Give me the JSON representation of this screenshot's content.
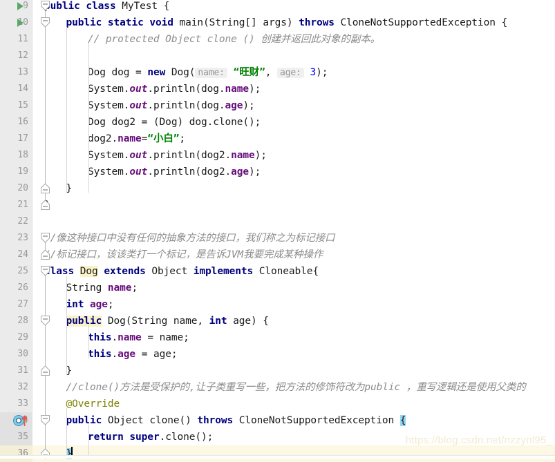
{
  "editor": {
    "app": "intellij-idea-code-editor",
    "language": "Java",
    "first_line_number": 9,
    "current_line": 36,
    "colors": {
      "background": "#ffffff",
      "gutter_background": "#ebebeb",
      "line_number": "#999999",
      "keyword": "#000080",
      "string": "#008000",
      "number": "#0000ff",
      "field": "#660e7a",
      "comment": "#8c8c8c",
      "annotation": "#808000",
      "current_line_highlight": "#fdf8e3",
      "identifier_highlight": "#fbf3c8",
      "brace_match_highlight": "#93d5f5",
      "run_marker_green": "#59a869",
      "override_icon_blue": "#4aa3df",
      "override_arrow_red": "#d9534f"
    },
    "watermark": "https://blog.csdn.net/nzzynl95_"
  },
  "lines": [
    {
      "num": "9",
      "gutter_icon": "run-triangle",
      "fold": "start",
      "indent": 0,
      "tokens": [
        {
          "t": "public",
          "c": "kw"
        },
        {
          "t": " ",
          "c": "plain"
        },
        {
          "t": "class",
          "c": "kw"
        },
        {
          "t": " MyTest {",
          "c": "plain"
        }
      ]
    },
    {
      "num": "10",
      "gutter_icon": "run-triangle",
      "fold": "start",
      "indent": 1,
      "tokens": [
        {
          "t": "public",
          "c": "kw"
        },
        {
          "t": " ",
          "c": "plain"
        },
        {
          "t": "static",
          "c": "kw"
        },
        {
          "t": " ",
          "c": "plain"
        },
        {
          "t": "void",
          "c": "kw"
        },
        {
          "t": " main(String[] args) ",
          "c": "plain"
        },
        {
          "t": "throws",
          "c": "kw"
        },
        {
          "t": " CloneNotSupportedException {",
          "c": "plain"
        }
      ]
    },
    {
      "num": "11",
      "gutter_icon": "",
      "fold": "",
      "indent": 2,
      "tokens": [
        {
          "t": "// protected Object clone () 创建并返回此对象的副本。",
          "c": "cmt"
        }
      ]
    },
    {
      "num": "12",
      "gutter_icon": "",
      "fold": "",
      "indent": 2,
      "tokens": []
    },
    {
      "num": "13",
      "gutter_icon": "",
      "fold": "",
      "indent": 2,
      "tokens": [
        {
          "t": "Dog dog = ",
          "c": "plain"
        },
        {
          "t": "new",
          "c": "kw"
        },
        {
          "t": " Dog(",
          "c": "plain"
        },
        {
          "t": "name:",
          "c": "hint"
        },
        {
          "t": " ",
          "c": "plain"
        },
        {
          "t": "“旺财”",
          "c": "str"
        },
        {
          "t": ", ",
          "c": "plain"
        },
        {
          "t": "age:",
          "c": "hint"
        },
        {
          "t": " ",
          "c": "plain"
        },
        {
          "t": "3",
          "c": "num"
        },
        {
          "t": ");",
          "c": "plain"
        }
      ]
    },
    {
      "num": "14",
      "gutter_icon": "",
      "fold": "",
      "indent": 2,
      "tokens": [
        {
          "t": "System.",
          "c": "plain"
        },
        {
          "t": "out",
          "c": "statfld"
        },
        {
          "t": ".println(dog.",
          "c": "plain"
        },
        {
          "t": "name",
          "c": "fieldref"
        },
        {
          "t": ");",
          "c": "plain"
        }
      ]
    },
    {
      "num": "15",
      "gutter_icon": "",
      "fold": "",
      "indent": 2,
      "tokens": [
        {
          "t": "System.",
          "c": "plain"
        },
        {
          "t": "out",
          "c": "statfld"
        },
        {
          "t": ".println(dog.",
          "c": "plain"
        },
        {
          "t": "age",
          "c": "fieldref"
        },
        {
          "t": ");",
          "c": "plain"
        }
      ]
    },
    {
      "num": "16",
      "gutter_icon": "",
      "fold": "",
      "indent": 2,
      "tokens": [
        {
          "t": "Dog dog2 = (Dog) dog.clone();",
          "c": "plain"
        }
      ]
    },
    {
      "num": "17",
      "gutter_icon": "",
      "fold": "",
      "indent": 2,
      "tokens": [
        {
          "t": "dog2.",
          "c": "plain"
        },
        {
          "t": "name",
          "c": "fieldref"
        },
        {
          "t": "=",
          "c": "plain"
        },
        {
          "t": "“小白”",
          "c": "str"
        },
        {
          "t": ";",
          "c": "plain"
        }
      ]
    },
    {
      "num": "18",
      "gutter_icon": "",
      "fold": "",
      "indent": 2,
      "tokens": [
        {
          "t": "System.",
          "c": "plain"
        },
        {
          "t": "out",
          "c": "statfld"
        },
        {
          "t": ".println(dog2.",
          "c": "plain"
        },
        {
          "t": "name",
          "c": "fieldref"
        },
        {
          "t": ");",
          "c": "plain"
        }
      ]
    },
    {
      "num": "19",
      "gutter_icon": "",
      "fold": "",
      "indent": 2,
      "tokens": [
        {
          "t": "System.",
          "c": "plain"
        },
        {
          "t": "out",
          "c": "statfld"
        },
        {
          "t": ".println(dog2.",
          "c": "plain"
        },
        {
          "t": "age",
          "c": "fieldref"
        },
        {
          "t": ");",
          "c": "plain"
        }
      ]
    },
    {
      "num": "20",
      "gutter_icon": "",
      "fold": "end",
      "indent": 1,
      "tokens": [
        {
          "t": "}",
          "c": "plain"
        }
      ]
    },
    {
      "num": "21",
      "gutter_icon": "",
      "fold": "end",
      "indent": 0,
      "tokens": [
        {
          "t": "}",
          "c": "plain"
        }
      ]
    },
    {
      "num": "22",
      "gutter_icon": "",
      "fold": "",
      "indent": 0,
      "tokens": []
    },
    {
      "num": "23",
      "gutter_icon": "",
      "fold": "start",
      "indent": 0,
      "tokens": [
        {
          "t": "//像这种接口中没有任何的抽象方法的接口，我们称之为标记接口",
          "c": "cmt"
        }
      ]
    },
    {
      "num": "24",
      "gutter_icon": "",
      "fold": "end",
      "indent": 0,
      "tokens": [
        {
          "t": "//标记接口，该该类打一个标记，是告诉JVM我要完成某种操作",
          "c": "cmt"
        }
      ]
    },
    {
      "num": "25",
      "gutter_icon": "",
      "fold": "start",
      "indent": 0,
      "tokens": [
        {
          "t": "class",
          "c": "kw"
        },
        {
          "t": " ",
          "c": "plain"
        },
        {
          "t": "Dog",
          "c": "hl-sym"
        },
        {
          "t": " ",
          "c": "plain"
        },
        {
          "t": "extends",
          "c": "kw"
        },
        {
          "t": " Object ",
          "c": "plain"
        },
        {
          "t": "implements",
          "c": "kw"
        },
        {
          "t": " Cloneable{",
          "c": "plain"
        }
      ]
    },
    {
      "num": "26",
      "gutter_icon": "",
      "fold": "",
      "indent": 1,
      "tokens": [
        {
          "t": "String ",
          "c": "plain"
        },
        {
          "t": "name",
          "c": "fieldref"
        },
        {
          "t": ";",
          "c": "plain"
        }
      ]
    },
    {
      "num": "27",
      "gutter_icon": "",
      "fold": "",
      "indent": 1,
      "tokens": [
        {
          "t": "int",
          "c": "kw"
        },
        {
          "t": " ",
          "c": "plain"
        },
        {
          "t": "age",
          "c": "fieldref"
        },
        {
          "t": ";",
          "c": "plain"
        }
      ]
    },
    {
      "num": "28",
      "gutter_icon": "",
      "fold": "start",
      "indent": 1,
      "tokens": [
        {
          "t": "public",
          "c": "kw hl-sym"
        },
        {
          "t": " Dog(String name, ",
          "c": "plain"
        },
        {
          "t": "int",
          "c": "kw"
        },
        {
          "t": " age) {",
          "c": "plain"
        }
      ]
    },
    {
      "num": "29",
      "gutter_icon": "",
      "fold": "",
      "indent": 2,
      "tokens": [
        {
          "t": "this",
          "c": "kw"
        },
        {
          "t": ".",
          "c": "plain"
        },
        {
          "t": "name",
          "c": "fieldref"
        },
        {
          "t": " = name;",
          "c": "plain"
        }
      ]
    },
    {
      "num": "30",
      "gutter_icon": "",
      "fold": "",
      "indent": 2,
      "tokens": [
        {
          "t": "this",
          "c": "kw"
        },
        {
          "t": ".",
          "c": "plain"
        },
        {
          "t": "age",
          "c": "fieldref"
        },
        {
          "t": " = age;",
          "c": "plain"
        }
      ]
    },
    {
      "num": "31",
      "gutter_icon": "",
      "fold": "end",
      "indent": 1,
      "tokens": [
        {
          "t": "}",
          "c": "plain"
        }
      ]
    },
    {
      "num": "32",
      "gutter_icon": "",
      "fold": "",
      "indent": 1,
      "tokens": [
        {
          "t": "//clone()方法是受保护的,让子类重写一些，把方法的修饰符改为public ，重写逻辑还是使用父类的",
          "c": "cmt"
        }
      ]
    },
    {
      "num": "33",
      "gutter_icon": "",
      "fold": "",
      "indent": 1,
      "tokens": [
        {
          "t": "@Override",
          "c": "anno"
        }
      ]
    },
    {
      "num": "34",
      "gutter_icon": "override-marker",
      "fold": "start",
      "indent": 1,
      "gutter_highlight": true,
      "tokens": [
        {
          "t": "public",
          "c": "kw"
        },
        {
          "t": " Object clone() ",
          "c": "plain"
        },
        {
          "t": "throws",
          "c": "kw"
        },
        {
          "t": " CloneNotSupportedException ",
          "c": "plain"
        },
        {
          "t": "{",
          "c": "brace-match"
        }
      ]
    },
    {
      "num": "35",
      "gutter_icon": "",
      "fold": "",
      "indent": 2,
      "gutter_highlight": true,
      "tokens": [
        {
          "t": "return",
          "c": "kw"
        },
        {
          "t": " ",
          "c": "plain"
        },
        {
          "t": "super",
          "c": "kw"
        },
        {
          "t": ".clone();",
          "c": "plain"
        }
      ]
    },
    {
      "num": "36",
      "gutter_icon": "",
      "fold": "end",
      "indent": 1,
      "current": true,
      "tokens": [
        {
          "t": "}",
          "c": "brace-match"
        },
        {
          "t": "",
          "c": "caret"
        }
      ]
    }
  ]
}
